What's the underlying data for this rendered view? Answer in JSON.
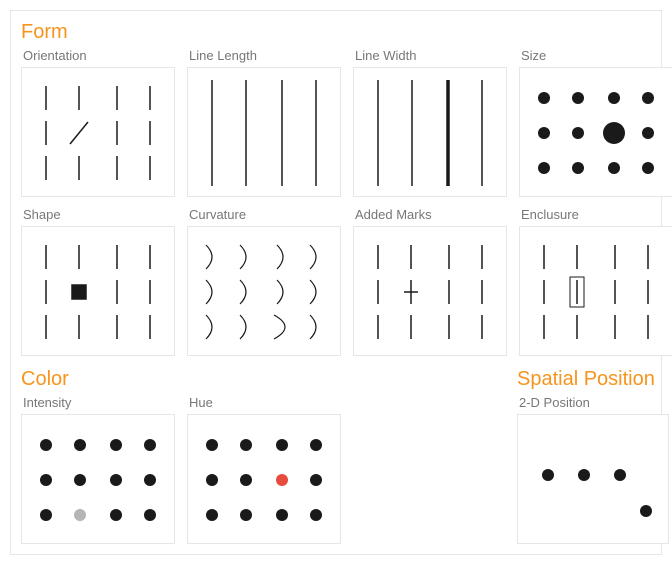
{
  "sections": {
    "form": {
      "title": "Form",
      "items": [
        {
          "key": "orientation",
          "label": "Orientation",
          "anomaly": "one bar rotated 45°"
        },
        {
          "key": "line_length",
          "label": "Line Length",
          "anomaly": "none shown (uniform long bars)"
        },
        {
          "key": "line_width",
          "label": "Line Width",
          "anomaly": "one bar thicker"
        },
        {
          "key": "size",
          "label": "Size",
          "anomaly": "one dot larger"
        },
        {
          "key": "shape",
          "label": "Shape",
          "anomaly": "one square among bars"
        },
        {
          "key": "curvature",
          "label": "Curvature",
          "anomaly": "one arc more open"
        },
        {
          "key": "added_marks",
          "label": "Added Marks",
          "anomaly": "one bar has a cross mark"
        },
        {
          "key": "enclosure",
          "label": "Enclusure",
          "anomaly": "one bar boxed"
        }
      ]
    },
    "color": {
      "title": "Color",
      "items": [
        {
          "key": "intensity",
          "label": "Intensity",
          "anomaly": "one dot light gray"
        },
        {
          "key": "hue",
          "label": "Hue",
          "anomaly": "one dot red"
        }
      ]
    },
    "spatial": {
      "title": "Spatial Position",
      "items": [
        {
          "key": "2d_position",
          "label": "2-D Position",
          "anomaly": "one dot displaced below row"
        }
      ]
    }
  },
  "grid": {
    "cols": 4,
    "rows": 3
  },
  "palette": {
    "accent": "#f7941d",
    "ink": "#1a1a1a",
    "red": "#e64c3c",
    "gray": "#b5b5b5"
  }
}
